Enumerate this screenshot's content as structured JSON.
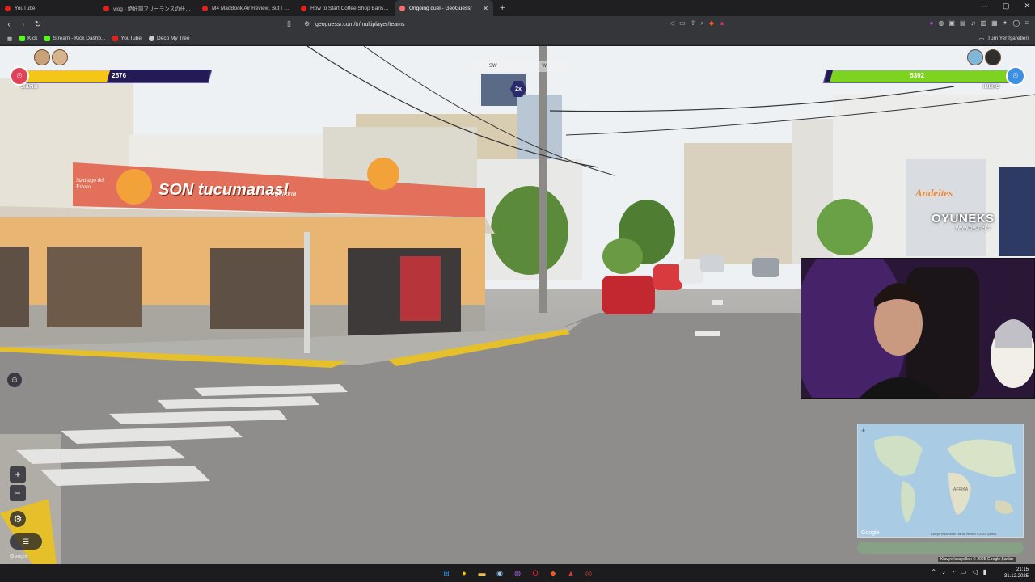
{
  "browser": {
    "tabs": [
      {
        "title": "YouTube",
        "color": "#e62117",
        "active": false
      },
      {
        "title": "vlog - 絶好調フリーランスの仕事早くした",
        "color": "#e62117",
        "active": false
      },
      {
        "title": "M4 MacBook Air Review, But I Respe",
        "color": "#e62117",
        "active": false
      },
      {
        "title": "How to Start Coffee Shop Barista Lo",
        "color": "#e62117",
        "active": false
      },
      {
        "title": "Ongoing duel - GeoGuessr",
        "color": "#ff6b6b",
        "active": true
      }
    ],
    "url": "geoguessr.com/tr/multiplayer/teams",
    "bookmarks": [
      {
        "label": "Kick",
        "color": "#53fc18"
      },
      {
        "label": "Stream - Kick Dashb...",
        "color": "#53fc18"
      },
      {
        "label": "YouTube",
        "color": "#e62117"
      },
      {
        "label": "Deco My Tree",
        "color": "#cccccc"
      }
    ],
    "all_bookmarks_label": "Tüm Yer İşaretleri"
  },
  "game": {
    "left_team": {
      "score": "2576",
      "health_fraction": 0.46,
      "name": "Sid/Net",
      "bar_color": "#f5c518",
      "pin_color": "#e0425a"
    },
    "right_team": {
      "score": "5392",
      "health_fraction": 0.97,
      "name": "IMBRO",
      "bar_color": "#7ed321",
      "pin_color": "#3d8fe0"
    },
    "compass": [
      "SW",
      "W"
    ],
    "multiplier": "2x",
    "sign_text": "SON tucumanas!",
    "sign_sub": "Santiago del Estero",
    "sign_country": "Argentina",
    "shop_sign": "Andeites"
  },
  "overlay": {
    "brand": "OYUNEKS",
    "brand_url": "www.oyuneks"
  },
  "map": {
    "labels": [
      "AFRIKA"
    ],
    "google": "Google",
    "attribution": "Klavye kısayolları  Harita verileri ©2025  Şartlar",
    "footer": "Klavye kısayolları  © 2025 Google  Şartlar"
  },
  "streetview": {
    "google": "Google"
  },
  "taskbar": {
    "time": "21:15",
    "date": "31.12.2025"
  }
}
